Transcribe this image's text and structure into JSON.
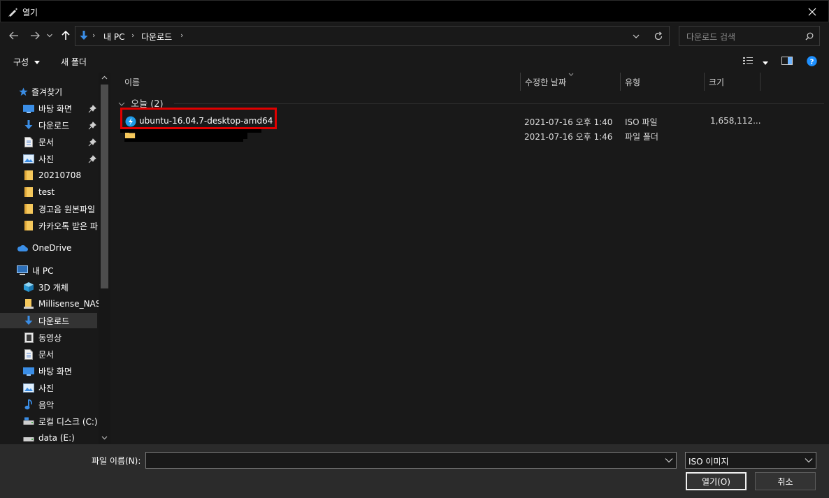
{
  "window": {
    "title": "열기",
    "close_glyph": "✕"
  },
  "nav": {
    "back_icon": "arrow-left-icon",
    "forward_icon": "arrow-right-icon",
    "recent_icon": "chevron-down-icon",
    "up_icon": "arrow-up-icon",
    "breadcrumbs": [
      "내 PC",
      "다운로드"
    ],
    "refresh_icon": "refresh-icon",
    "search_placeholder": "다운로드 검색"
  },
  "toolbar": {
    "organize_label": "구성",
    "new_folder_label": "새 폴더"
  },
  "sidebar": {
    "items": [
      {
        "label": "즐겨찾기",
        "icon": "star-icon",
        "pinned": false
      },
      {
        "label": "바탕 화면",
        "icon": "desktop-icon",
        "pinned": true
      },
      {
        "label": "다운로드",
        "icon": "download-icon",
        "pinned": true
      },
      {
        "label": "문서",
        "icon": "document-icon",
        "pinned": true
      },
      {
        "label": "사진",
        "icon": "pictures-icon",
        "pinned": true
      },
      {
        "label": "20210708",
        "icon": "folder-icon",
        "pinned": false
      },
      {
        "label": "test",
        "icon": "folder-icon",
        "pinned": false
      },
      {
        "label": "경고음 원본파일",
        "icon": "folder-icon",
        "pinned": false
      },
      {
        "label": "카카오톡 받은 파",
        "icon": "folder-icon",
        "pinned": false
      },
      {
        "label": "OneDrive",
        "icon": "cloud-icon",
        "pinned": false
      },
      {
        "label": "내 PC",
        "icon": "computer-icon",
        "pinned": false
      },
      {
        "label": "3D 개체",
        "icon": "cube-icon",
        "pinned": false
      },
      {
        "label": "Millisense_NAS",
        "icon": "folder-icon",
        "pinned": false
      },
      {
        "label": "다운로드",
        "icon": "download-icon",
        "pinned": false,
        "selected": true
      },
      {
        "label": "동영상",
        "icon": "video-icon",
        "pinned": false
      },
      {
        "label": "문서",
        "icon": "document-icon",
        "pinned": false
      },
      {
        "label": "바탕 화면",
        "icon": "desktop-icon",
        "pinned": false
      },
      {
        "label": "사진",
        "icon": "pictures-icon",
        "pinned": false
      },
      {
        "label": "음악",
        "icon": "music-icon",
        "pinned": false
      },
      {
        "label": "로컬 디스크 (C:)",
        "icon": "drive-icon",
        "pinned": false
      },
      {
        "label": "data (E:)",
        "icon": "drive-icon",
        "pinned": false
      }
    ]
  },
  "columns": {
    "name": "이름",
    "modified": "수정한 날짜",
    "type": "유형",
    "size": "크기"
  },
  "group": {
    "label": "오늘 (2)"
  },
  "files": [
    {
      "name": "ubuntu-16.04.7-desktop-amd64",
      "modified": "2021-07-16 오후 1:40",
      "type": "ISO 파일",
      "size": "1,658,112...",
      "icon": "disc-image-icon",
      "highlighted": true
    },
    {
      "name": "",
      "modified": "2021-07-16 오후 1:46",
      "type": "파일 폴더",
      "size": "",
      "icon": "folder-icon",
      "redacted": true
    }
  ],
  "footer": {
    "filename_label": "파일 이름(N):",
    "filename_value": "",
    "filetype_value": "ISO 이미지",
    "open_label": "열기(O)",
    "cancel_label": "취소"
  },
  "colors": {
    "highlight_border": "#e00000",
    "accent_blue": "#1e90ff"
  }
}
